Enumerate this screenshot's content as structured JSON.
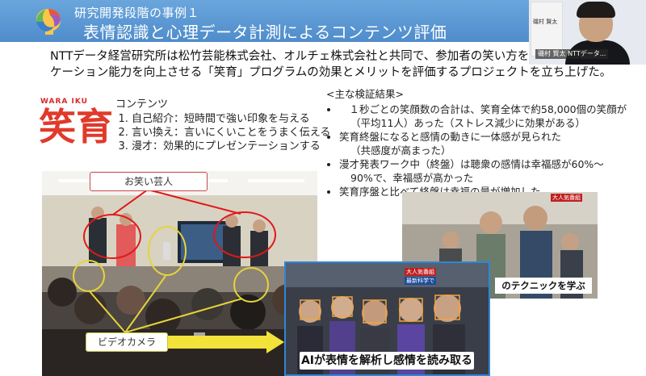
{
  "header": {
    "subtitle": "研究開発段階の事例１",
    "title": "表情認識と心理データ計測によるコンテンツ評価"
  },
  "intro": {
    "line1": "NTTデータ経営研究所は松竹芸能株式会社、オルチェ株式会社と共同で、参加者の笑い方を教育するコミュニ",
    "line2": "ケーション能力を向上させる「笑育」プログラムの効果とメリットを評価するプロジェクトを立ち上げた。"
  },
  "brand": {
    "roman": "WARA  IKU",
    "kanji": "笑育"
  },
  "contents": {
    "title": "コンテンツ",
    "items": [
      "自己紹介：短時間で強い印象を与える",
      "言い換え：言いにくいことをうまく伝える",
      "漫才：効果的にプレゼンテーションする"
    ]
  },
  "results": {
    "title": "<主な検証結果>",
    "items": [
      "　１秒ごとの笑顔数の合計は、笑育全体で約58,000個の笑顔が",
      "（平均11人）あった（ストレス減少に効果がある）",
      "笑育終盤になると感情の動きに一体感が見られた",
      "（共感度が高まった）",
      "漫才発表ワーク中（終盤）は聴衆の感情は幸福感が60%～",
      "90%で、幸福感が高かった",
      "笑育序盤と比べて終盤は幸福の量が増加した"
    ]
  },
  "callouts": {
    "geinin": "お笑い芸人",
    "camera": "ビデオカメラ"
  },
  "captions": {
    "bottom": "AIが表情を解析し感情を読み取る",
    "right": "のテクニックを学ぶ",
    "tv_tag_red": "大人気番組",
    "tv_tag_blue": "最新科学で"
  },
  "video": {
    "name": "磯村 賢太 NTTデータ...",
    "book_title": "磯村 賢太"
  },
  "colors": {
    "header": "#5b9bd5",
    "brand_red": "#e03a2b",
    "circle_red": "#e01818",
    "circle_yellow": "#e6d43a",
    "frame_blue": "#2f86d6"
  }
}
